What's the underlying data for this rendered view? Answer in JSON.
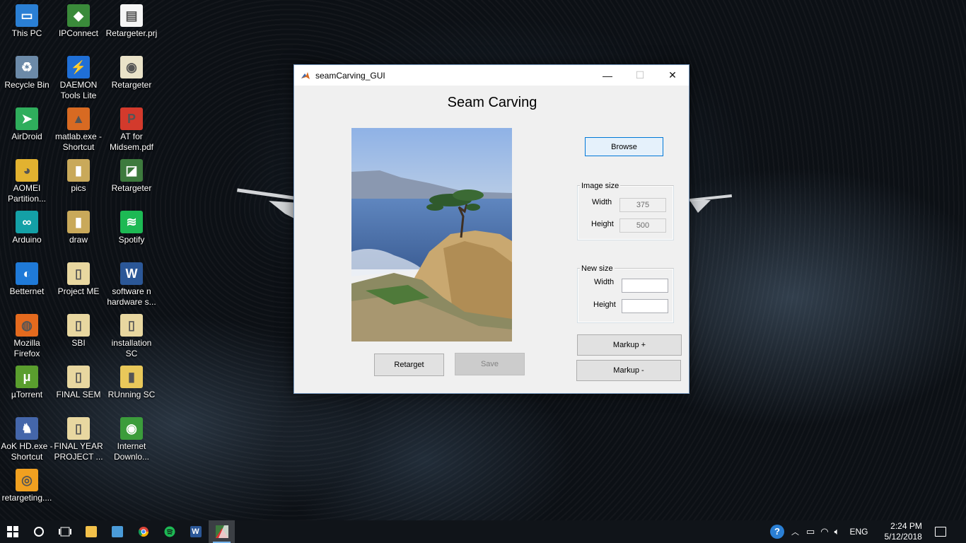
{
  "desktop": {
    "icons": [
      {
        "label": "This PC",
        "color": "#2a7fd4",
        "glyph": "▭"
      },
      {
        "label": "IPConnect",
        "color": "#3a8a3a",
        "glyph": "◆"
      },
      {
        "label": "Retargeter.prj",
        "color": "#f5f5f5",
        "glyph": "▤"
      },
      {
        "label": "Recycle Bin",
        "color": "#6c8aa8",
        "glyph": "♻"
      },
      {
        "label": "DAEMON Tools Lite",
        "color": "#1f6fd6",
        "glyph": "⚡"
      },
      {
        "label": "Retargeter",
        "color": "#e9e2c8",
        "glyph": "◉"
      },
      {
        "label": "AirDroid",
        "color": "#2fae5c",
        "glyph": "➤"
      },
      {
        "label": "matlab.exe - Shortcut",
        "color": "#d86a22",
        "glyph": "▲"
      },
      {
        "label": "AT for Midsem.pdf",
        "color": "#d33a2c",
        "glyph": "P"
      },
      {
        "label": "AOMEI Partition...",
        "color": "#e2b230",
        "glyph": "◕"
      },
      {
        "label": "pics",
        "color": "#c9a95a",
        "glyph": "▮"
      },
      {
        "label": "Retargeter",
        "color": "#3d7a3d",
        "glyph": "◪"
      },
      {
        "label": "Arduino",
        "color": "#14a0a6",
        "glyph": "∞"
      },
      {
        "label": "draw",
        "color": "#c9a95a",
        "glyph": "▮"
      },
      {
        "label": "Spotify",
        "color": "#1db954",
        "glyph": "≋"
      },
      {
        "label": "Betternet",
        "color": "#1f7ad8",
        "glyph": "◐"
      },
      {
        "label": "Project ME",
        "color": "#e8d7a0",
        "glyph": "▯"
      },
      {
        "label": "software n hardware s...",
        "color": "#2b5797",
        "glyph": "W"
      },
      {
        "label": "Mozilla Firefox",
        "color": "#e46a1e",
        "glyph": "◍"
      },
      {
        "label": "SBI",
        "color": "#e8d7a0",
        "glyph": "▯"
      },
      {
        "label": "installation SC",
        "color": "#e8d7a0",
        "glyph": "▯"
      },
      {
        "label": "µTorrent",
        "color": "#5a9e2e",
        "glyph": "μ"
      },
      {
        "label": "FINAL SEM",
        "color": "#e8d7a0",
        "glyph": "▯"
      },
      {
        "label": "RUnning SC",
        "color": "#e9c85a",
        "glyph": "▮"
      },
      {
        "label": "AoK HD.exe - Shortcut",
        "color": "#4466aa",
        "glyph": "♞"
      },
      {
        "label": "FINAL YEAR PROJECT ...",
        "color": "#e8d7a0",
        "glyph": "▯"
      },
      {
        "label": "Internet Downlo...",
        "color": "#3b9c3b",
        "glyph": "◉"
      },
      {
        "label": "retargeting....",
        "color": "#f0a020",
        "glyph": "◎"
      }
    ]
  },
  "window": {
    "title": "seamCarving_GUI",
    "minimize": "—",
    "maximize": "☐",
    "close": "✕",
    "heading": "Seam Carving",
    "browse_label": "Browse",
    "image_size": {
      "group_label": "Image size",
      "width_label": "Width",
      "width_value": "375",
      "height_label": "Height",
      "height_value": "500"
    },
    "new_size": {
      "group_label": "New size",
      "width_label": "Width",
      "width_value": "",
      "height_label": "Height",
      "height_value": ""
    },
    "markup_plus_label": "Markup +",
    "markup_minus_label": "Markup -",
    "retarget_label": "Retarget",
    "save_label": "Save"
  },
  "taskbar": {
    "language": "ENG",
    "time": "2:24 PM",
    "date": "5/12/2018"
  }
}
